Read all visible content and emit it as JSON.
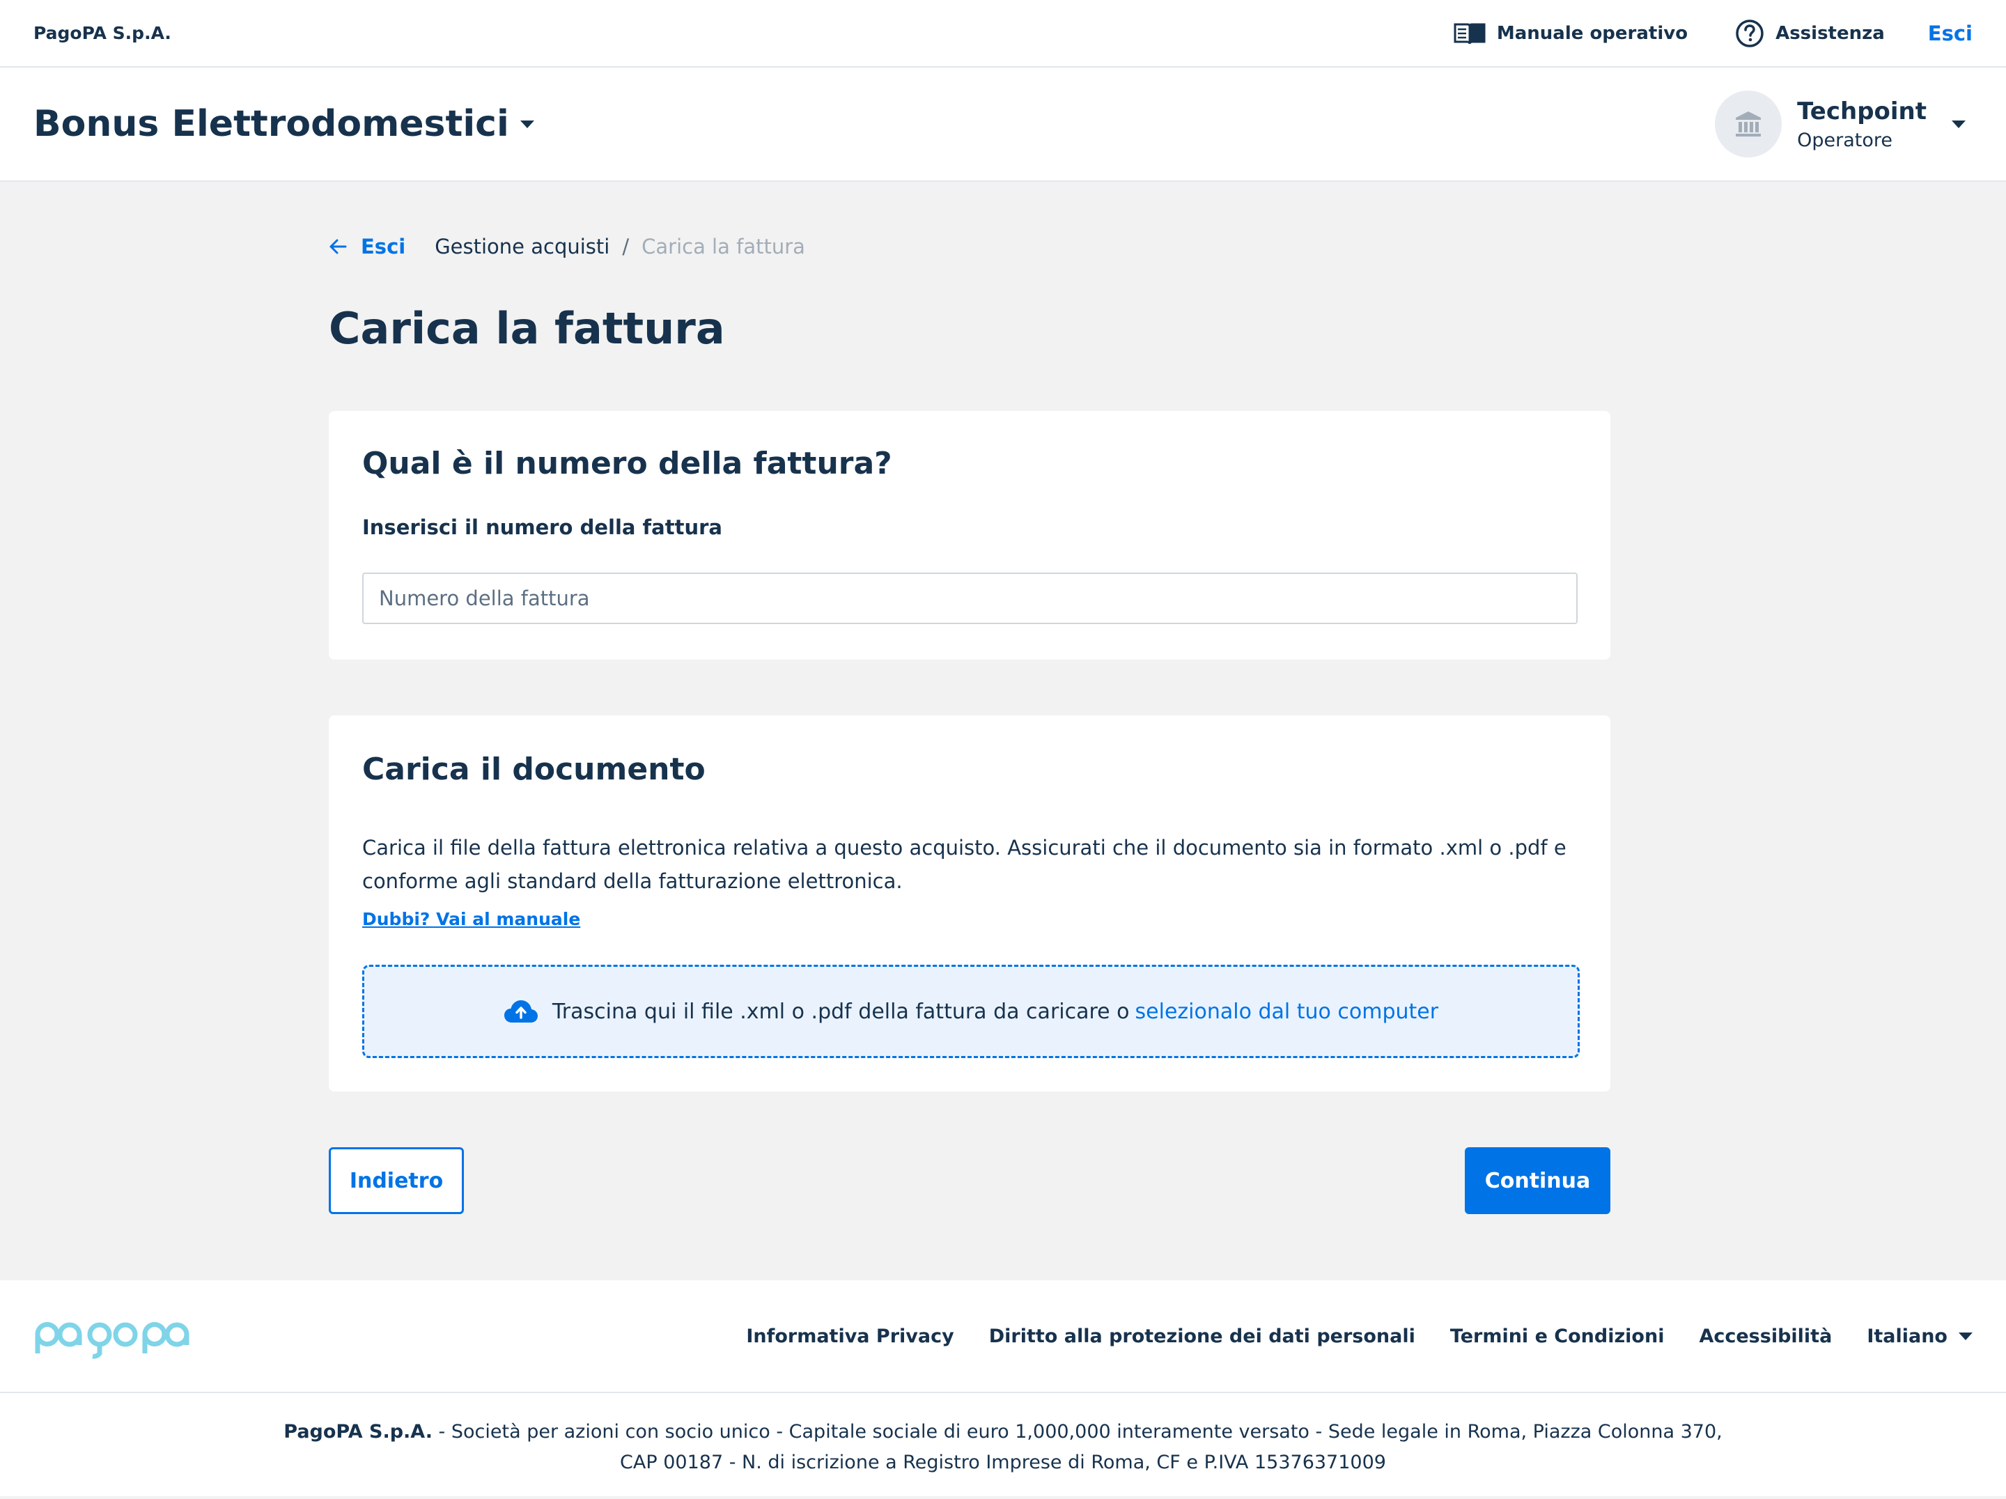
{
  "topbar": {
    "company": "PagoPA S.p.A.",
    "manual_label": "Manuale operativo",
    "support_label": "Assistenza",
    "exit_label": "Esci"
  },
  "header": {
    "product_title": "Bonus Elettrodomestici",
    "party_name": "Techpoint",
    "party_role": "Operatore"
  },
  "breadcrumb": {
    "back_label": "Esci",
    "items": [
      "Gestione acquisti",
      "Carica la fattura"
    ],
    "separator": "/"
  },
  "page": {
    "title": "Carica la fattura"
  },
  "invoice_number_card": {
    "heading": "Qual è il numero della fattura?",
    "field_label": "Inserisci il numero della fattura",
    "input_value": "",
    "input_placeholder": "Numero della fattura"
  },
  "document_card": {
    "heading": "Carica il documento",
    "description": "Carica il file della fattura elettronica relativa a questo acquisto. Assicurati che il documento sia in formato .xml o .pdf e conforme agli standard della fatturazione elettronica.",
    "manual_link": "Dubbi? Vai al manuale",
    "dropzone_text": "Trascina qui il file .xml o .pdf della fattura da caricare o",
    "dropzone_link": "selezionalo dal tuo computer"
  },
  "actions": {
    "back_label": "Indietro",
    "continue_label": "Continua"
  },
  "footer": {
    "logo_text": "pagopa",
    "links": [
      "Informativa Privacy",
      "Diritto alla protezione dei dati personali",
      "Termini e Condizioni",
      "Accessibilità"
    ],
    "language": "Italiano",
    "legal_company": "PagoPA S.p.A.",
    "legal_line1": " - Società per azioni con socio unico - Capitale sociale di euro 1,000,000 interamente versato - Sede legale in Roma, Piazza Colonna 370,",
    "legal_line2": "CAP 00187 - N. di iscrizione a Registro Imprese di Roma, CF e P.IVA 15376371009"
  },
  "colors": {
    "primary": "#0073e6",
    "text": "#17324d",
    "background": "#f2f2f2",
    "dropzone_bg": "#eaf3fd",
    "logo": "#7fd4e8"
  },
  "icons": [
    "book-icon",
    "help-circle-icon",
    "arrow-left-icon",
    "bank-icon",
    "cloud-upload-icon",
    "chevron-down-icon",
    "pagopa-logo"
  ]
}
